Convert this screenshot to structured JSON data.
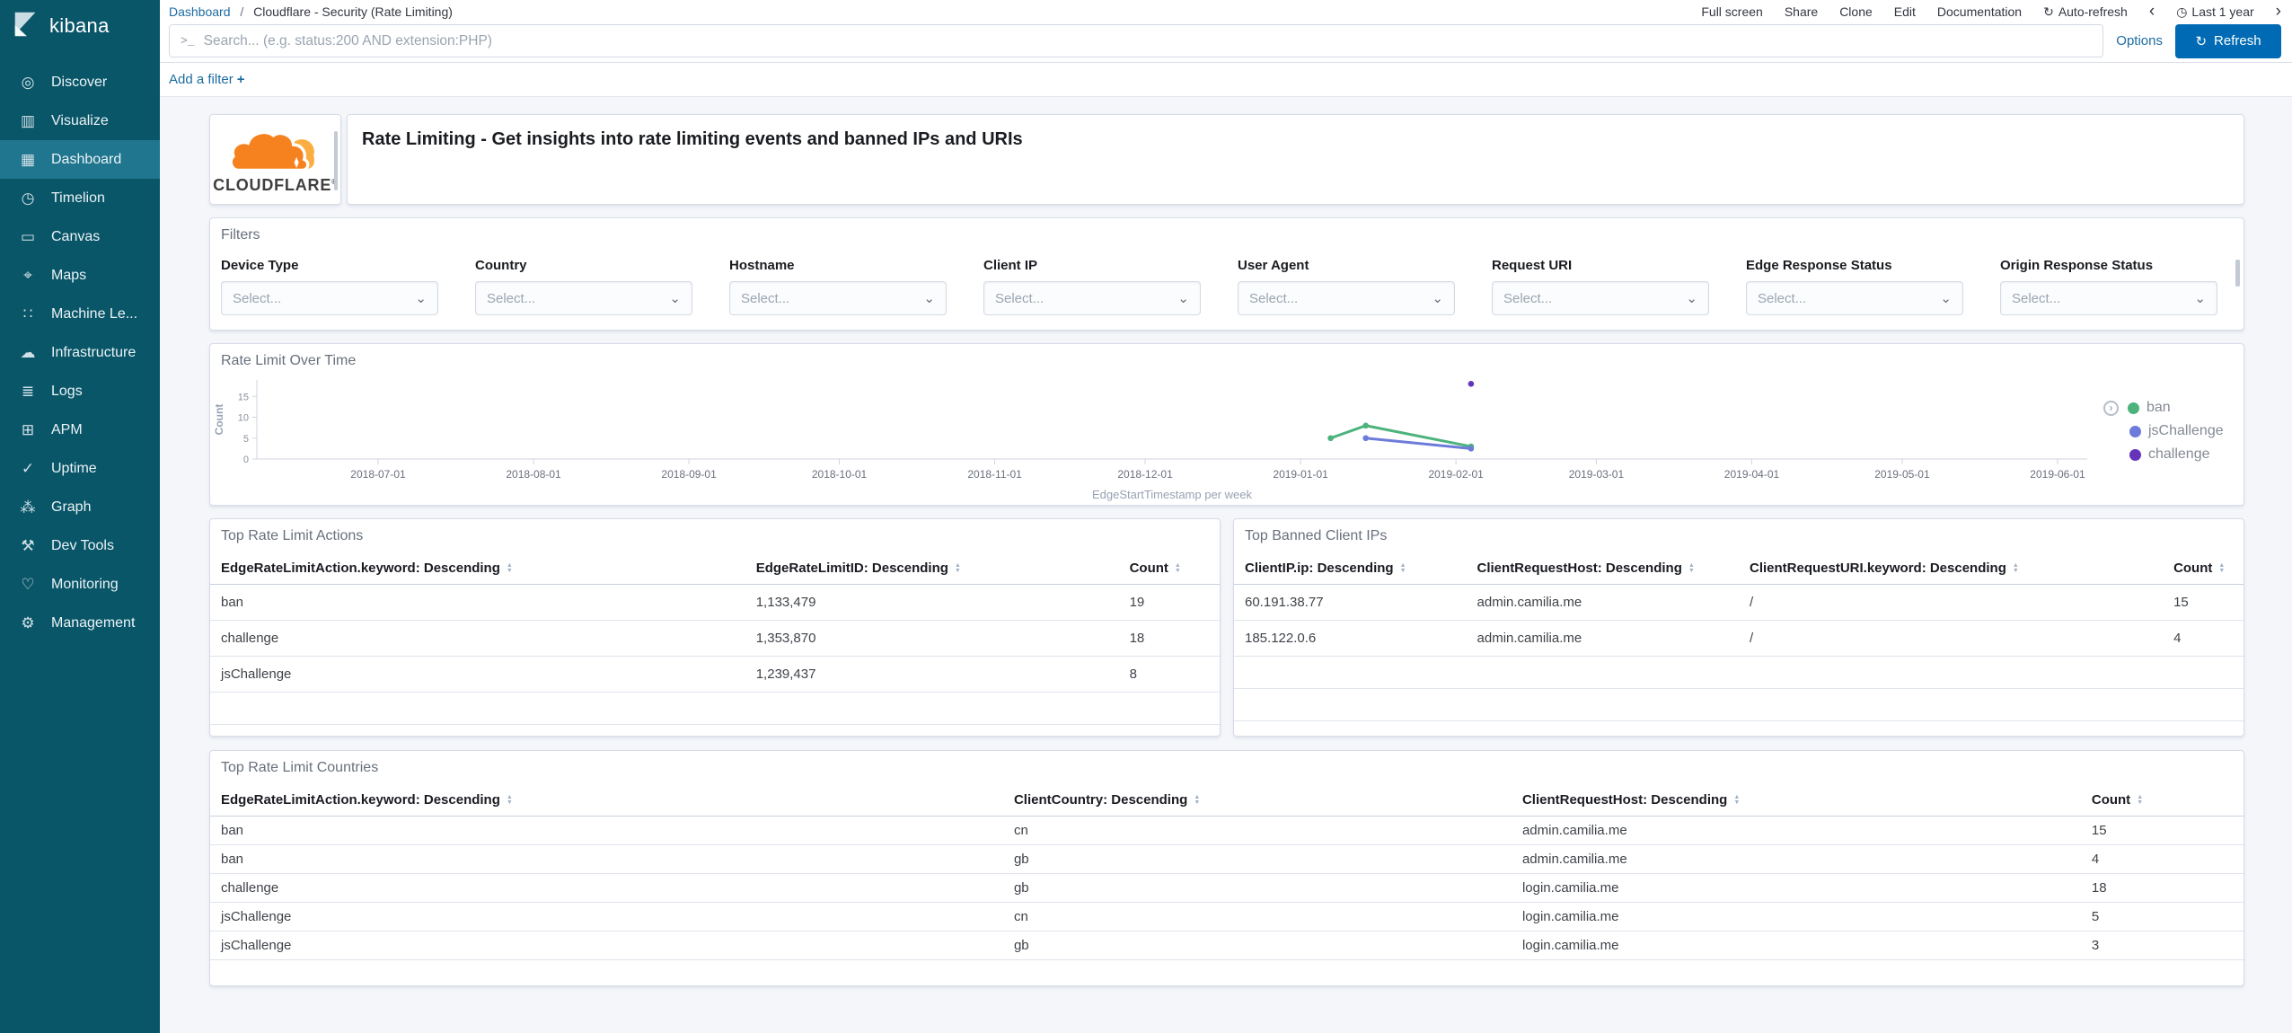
{
  "icons": {
    "refresh": "↻",
    "clock": "◷",
    "chevron_left": "‹",
    "chevron_right": "›",
    "terminal": ">_",
    "plus": "+",
    "select_chevron": "⌄",
    "sort_up": "▲",
    "sort_down": "▼",
    "legend_toggle": "›"
  },
  "colors": {
    "accent_blue": "#006BB4",
    "link_blue": "#1C6CA1",
    "sidebar_bg": "#0A5669",
    "sidebar_active_bg": "#20768E",
    "orange_primary": "#F6821F",
    "orange_light": "#FBAD41",
    "series_ban": "#4CB37D",
    "series_jschallenge": "#6D7CDA",
    "series_challenge": "#6435BB"
  },
  "chrome": {
    "brand": "kibana",
    "breadcrumb": {
      "root": "Dashboard",
      "separator": "/",
      "current": "Cloudflare - Security (Rate Limiting)"
    },
    "top_menu": {
      "items": [
        "Full screen",
        "Share",
        "Clone",
        "Edit",
        "Documentation"
      ],
      "auto_refresh": "Auto-refresh",
      "time_label": "Last 1 year"
    },
    "search": {
      "placeholder": "Search... (e.g. status:200 AND extension:PHP)",
      "options": "Options",
      "refresh": "Refresh"
    },
    "add_filter": "Add a filter"
  },
  "sidebar": {
    "items": [
      {
        "id": "discover",
        "label": "Discover",
        "icon": "compass-icon",
        "glyph": "◎",
        "active": false
      },
      {
        "id": "visualize",
        "label": "Visualize",
        "icon": "bar-chart-icon",
        "glyph": "▥",
        "active": false
      },
      {
        "id": "dashboard",
        "label": "Dashboard",
        "icon": "dashboard-grid-icon",
        "glyph": "▦",
        "active": true
      },
      {
        "id": "timelion",
        "label": "Timelion",
        "icon": "timelion-clock-icon",
        "glyph": "◷",
        "active": false
      },
      {
        "id": "canvas",
        "label": "Canvas",
        "icon": "canvas-frame-icon",
        "glyph": "▭",
        "active": false
      },
      {
        "id": "maps",
        "label": "Maps",
        "icon": "map-pin-icon",
        "glyph": "⌖",
        "active": false
      },
      {
        "id": "machine-learning",
        "label": "Machine Le...",
        "icon": "machine-learning-icon",
        "glyph": "∷",
        "active": false
      },
      {
        "id": "infrastructure",
        "label": "Infrastructure",
        "icon": "cloud-server-icon",
        "glyph": "☁",
        "active": false
      },
      {
        "id": "logs",
        "label": "Logs",
        "icon": "log-scroll-icon",
        "glyph": "≣",
        "active": false
      },
      {
        "id": "apm",
        "label": "APM",
        "icon": "apm-traces-icon",
        "glyph": "⊞",
        "active": false
      },
      {
        "id": "uptime",
        "label": "Uptime",
        "icon": "uptime-check-icon",
        "glyph": "✓",
        "active": false
      },
      {
        "id": "graph",
        "label": "Graph",
        "icon": "graph-network-icon",
        "glyph": "⁂",
        "active": false
      },
      {
        "id": "dev-tools",
        "label": "Dev Tools",
        "icon": "wrench-icon",
        "glyph": "⚒",
        "active": false
      },
      {
        "id": "monitoring",
        "label": "Monitoring",
        "icon": "heartbeat-icon",
        "glyph": "♡",
        "active": false
      },
      {
        "id": "management",
        "label": "Management",
        "icon": "gear-icon",
        "glyph": "⚙",
        "active": false
      }
    ]
  },
  "panels": {
    "logo": {
      "brand": "CLOUDFLARE",
      "registered": "®"
    },
    "title": {
      "text": "Rate Limiting - Get insights into rate limiting events and banned IPs and URIs"
    },
    "filters": {
      "title": "Filters",
      "placeholder": "Select...",
      "fields": [
        "Device Type",
        "Country",
        "Hostname",
        "Client IP",
        "User Agent",
        "Request URI",
        "Edge Response Status",
        "Origin Response Status"
      ]
    },
    "chart": {
      "title": "Rate Limit Over Time"
    },
    "actions_table": {
      "title": "Top Rate Limit Actions",
      "columns": [
        "EdgeRateLimitAction.keyword: Descending",
        "EdgeRateLimitID: Descending",
        "Count"
      ],
      "rows": [
        [
          "ban",
          "1,133,479",
          "19"
        ],
        [
          "challenge",
          "1,353,870",
          "18"
        ],
        [
          "jsChallenge",
          "1,239,437",
          "8"
        ]
      ]
    },
    "banned_table": {
      "title": "Top Banned Client IPs",
      "columns": [
        "ClientIP.ip: Descending",
        "ClientRequestHost: Descending",
        "ClientRequestURI.keyword: Descending",
        "Count"
      ],
      "rows": [
        [
          "60.191.38.77",
          "admin.camilia.me",
          "/",
          "15"
        ],
        [
          "185.122.0.6",
          "admin.camilia.me",
          "/",
          "4"
        ]
      ]
    },
    "countries_table": {
      "title": "Top Rate Limit Countries",
      "columns": [
        "EdgeRateLimitAction.keyword: Descending",
        "ClientCountry: Descending",
        "ClientRequestHost: Descending",
        "Count"
      ],
      "rows": [
        [
          "ban",
          "cn",
          "admin.camilia.me",
          "15"
        ],
        [
          "ban",
          "gb",
          "admin.camilia.me",
          "4"
        ],
        [
          "challenge",
          "gb",
          "login.camilia.me",
          "18"
        ],
        [
          "jsChallenge",
          "cn",
          "login.camilia.me",
          "5"
        ],
        [
          "jsChallenge",
          "gb",
          "login.camilia.me",
          "3"
        ]
      ]
    }
  },
  "chart_data": {
    "type": "line",
    "title": "Rate Limit Over Time",
    "xlabel": "EdgeStartTimestamp per week",
    "ylabel": "Count",
    "ylim": [
      0,
      20
    ],
    "yticks": [
      0,
      5,
      10,
      15
    ],
    "xticks": [
      "2018-07-01",
      "2018-08-01",
      "2018-09-01",
      "2018-10-01",
      "2018-11-01",
      "2018-12-01",
      "2019-01-01",
      "2019-02-01",
      "2019-03-01",
      "2019-04-01",
      "2019-05-01",
      "2019-06-01"
    ],
    "legend_position": "right",
    "series": [
      {
        "name": "ban",
        "color": "#4CB37D",
        "points": [
          [
            "2019-01-07",
            5
          ],
          [
            "2019-01-14",
            8
          ],
          [
            "2019-02-04",
            3
          ]
        ]
      },
      {
        "name": "jsChallenge",
        "color": "#6D7CDA",
        "points": [
          [
            "2019-01-14",
            5
          ],
          [
            "2019-02-04",
            2.5
          ]
        ]
      },
      {
        "name": "challenge",
        "color": "#6435BB",
        "points": [
          [
            "2019-02-04",
            18
          ]
        ]
      }
    ]
  }
}
